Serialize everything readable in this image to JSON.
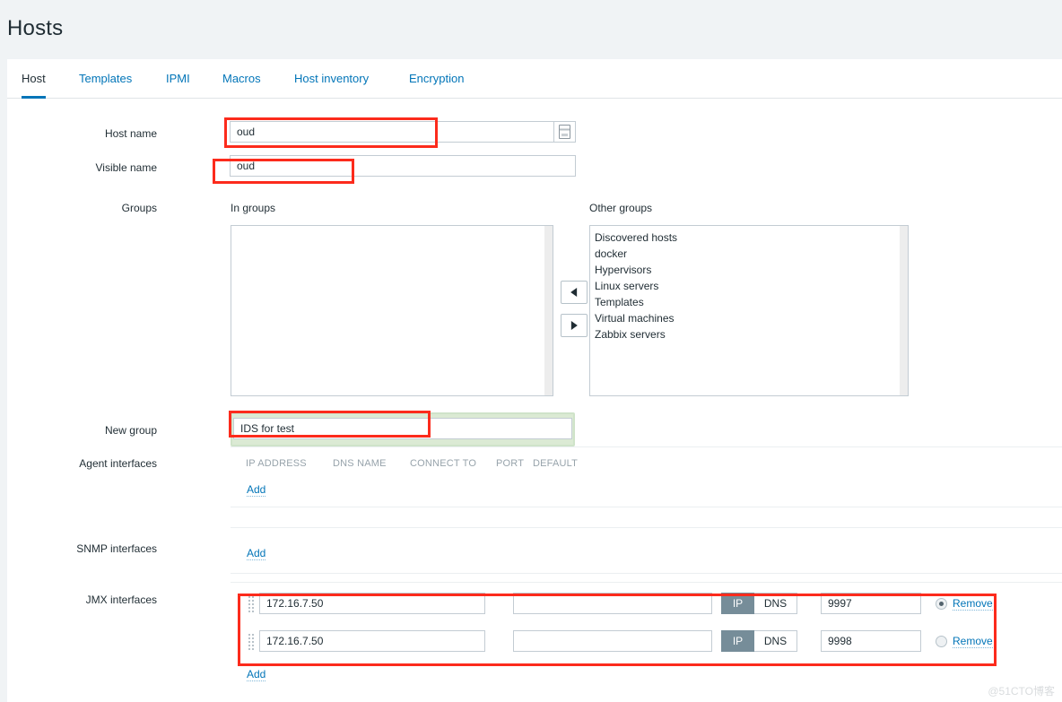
{
  "header": {
    "title": "Hosts"
  },
  "tabs": [
    {
      "label": "Host",
      "active": true
    },
    {
      "label": "Templates",
      "active": false
    },
    {
      "label": "IPMI",
      "active": false
    },
    {
      "label": "Macros",
      "active": false
    },
    {
      "label": "Host inventory",
      "active": false
    },
    {
      "label": "Encryption",
      "active": false
    }
  ],
  "form": {
    "host_name": {
      "label": "Host name",
      "value": "oud",
      "placeholder": ""
    },
    "visible_name": {
      "label": "Visible name",
      "value": "oud",
      "placeholder": ""
    },
    "groups": {
      "label": "Groups",
      "in_groups_caption": "In groups",
      "other_groups_caption": "Other groups",
      "in_groups": [],
      "other_groups": [
        "Discovered hosts",
        "docker",
        "Hypervisors",
        "Linux servers",
        "Templates",
        "Virtual machines",
        "Zabbix servers"
      ]
    },
    "new_group": {
      "label": "New group",
      "value": "IDS for test",
      "placeholder": ""
    },
    "agent_interfaces": {
      "label": "Agent interfaces",
      "columns": [
        "IP ADDRESS",
        "DNS NAME",
        "CONNECT TO",
        "PORT",
        "DEFAULT"
      ],
      "add_label": "Add",
      "rows": []
    },
    "snmp_interfaces": {
      "label": "SNMP interfaces",
      "add_label": "Add",
      "rows": []
    },
    "jmx_interfaces": {
      "label": "JMX interfaces",
      "add_label": "Add",
      "connect_ip_label": "IP",
      "connect_dns_label": "DNS",
      "remove_label": "Remove",
      "rows": [
        {
          "ip": "172.16.7.50",
          "dns": "",
          "connect_to": "IP",
          "port": "9997",
          "default": true
        },
        {
          "ip": "172.16.7.50",
          "dns": "",
          "connect_to": "IP",
          "port": "9998",
          "default": false
        }
      ]
    }
  },
  "watermark": "@51CTO博客",
  "colors": {
    "accent": "#0275b8",
    "annotation": "#fc2b1c",
    "focus_green": "#dbead4",
    "segment_selected": "#768d99",
    "page_bg": "#f0f3f5"
  }
}
